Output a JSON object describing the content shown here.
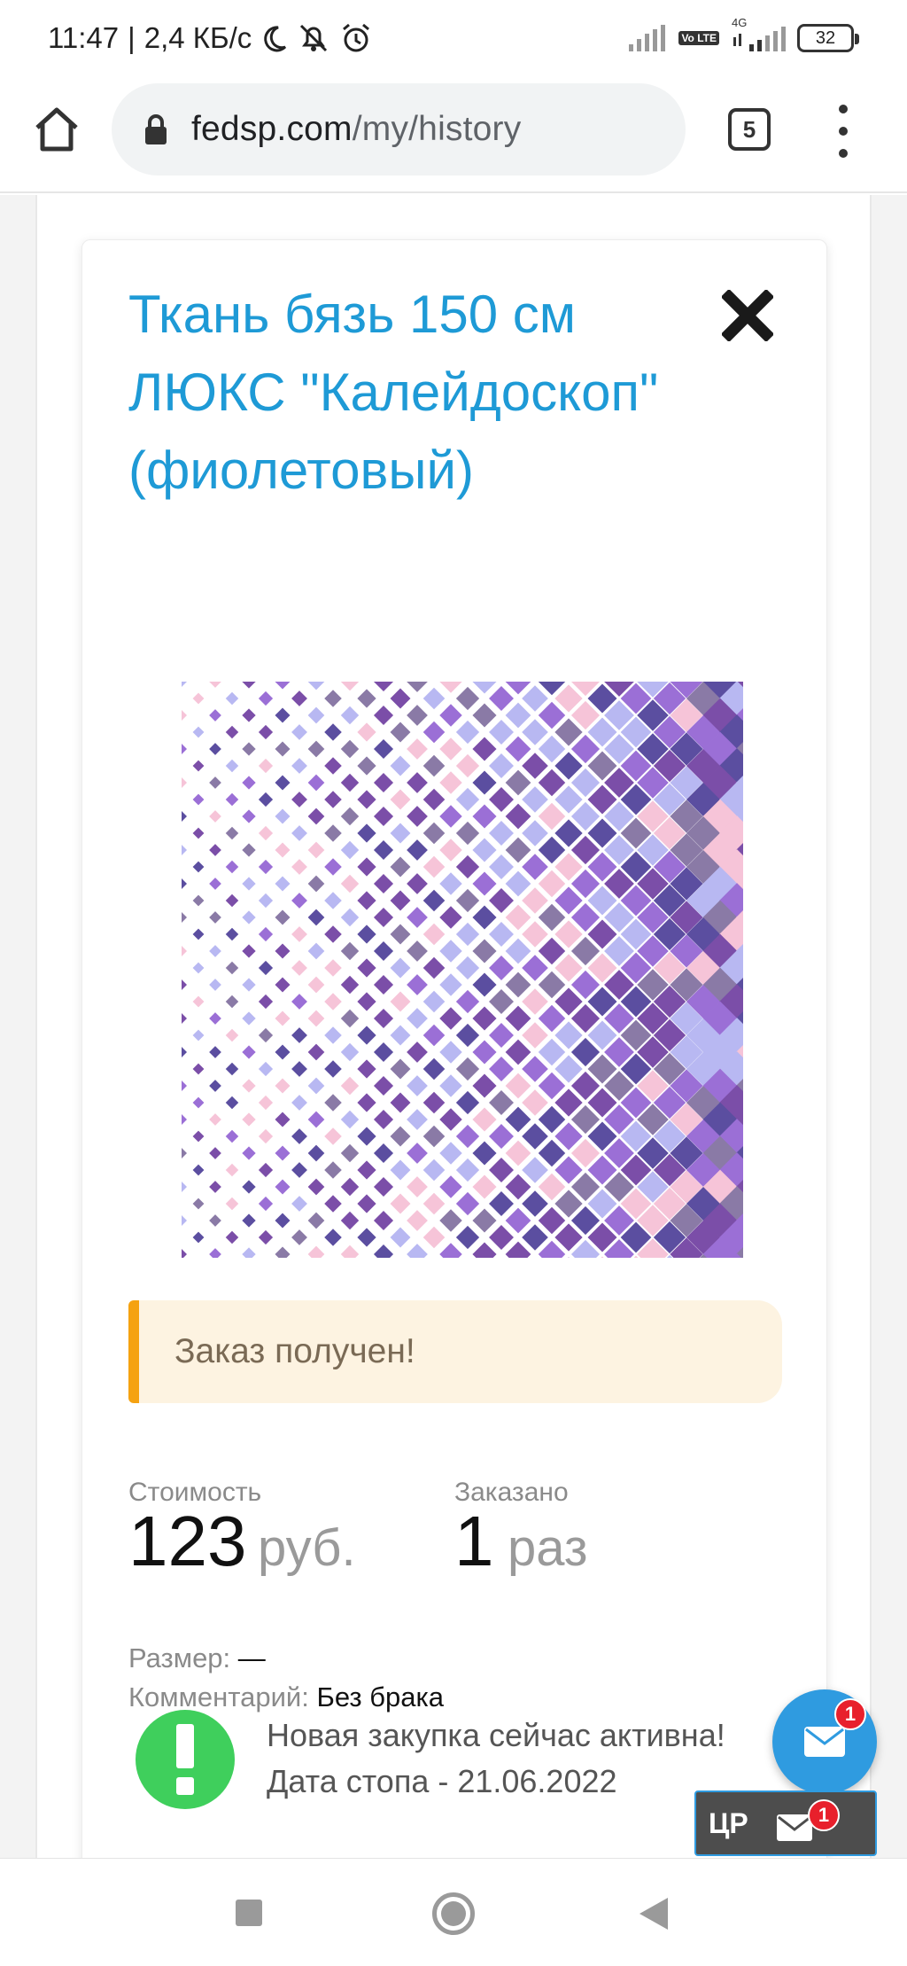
{
  "status_bar": {
    "time": "11:47",
    "speed": "2,4 КБ/с",
    "network": "4G",
    "volte": "Vo LTE",
    "battery": "32"
  },
  "browser": {
    "domain": "fedsp.com",
    "path": "/my/history",
    "tab_count": "5"
  },
  "order": {
    "title": "Ткань бязь 150 см ЛЮКС \"Калейдоскоп\" (фиолетовый)",
    "status": "Заказ получен!",
    "cost_label": "Стоимость",
    "cost_value": "123",
    "cost_unit": "руб.",
    "ordered_label": "Заказано",
    "ordered_value": "1",
    "ordered_unit": "раз",
    "size_label": "Размер:",
    "size_value": "—",
    "comment_label": "Комментарий:",
    "comment_value": "Без брака"
  },
  "notice": {
    "line1": "Новая закупка сейчас активна!",
    "line2": "Дата стопа - 21.06.2022"
  },
  "widgets": {
    "chat_badge": "1",
    "cr_label": "ЦР",
    "cr_badge": "1"
  },
  "colors": {
    "title": "#1e9ad6",
    "alert_border": "#f5a211",
    "alert_bg": "#fdf3e1",
    "notice_green": "#3fcf5c",
    "chat_blue": "#2f9be0",
    "badge_red": "#e8202c",
    "fabric_palette": [
      "#7b4ea8",
      "#9b6fd6",
      "#b8b8f2",
      "#f6c4d8",
      "#5b4ea0",
      "#8a7aa6"
    ]
  }
}
